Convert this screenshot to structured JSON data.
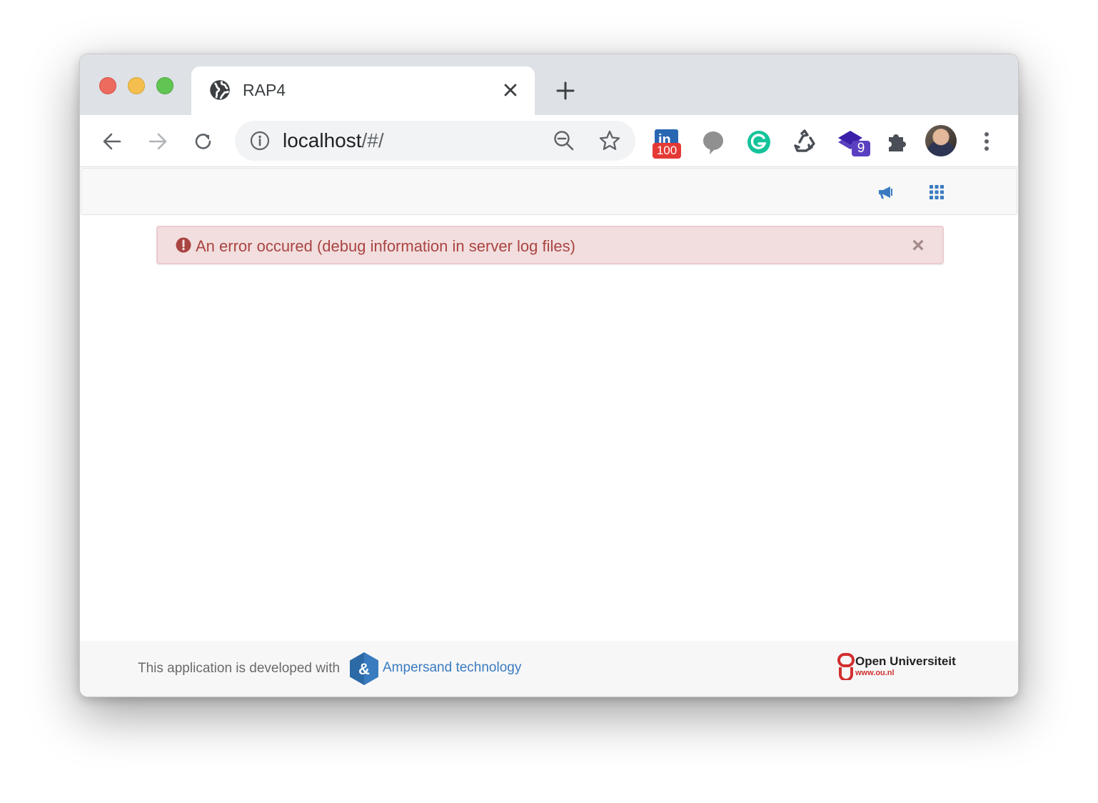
{
  "browser": {
    "tab": {
      "title": "RAP4",
      "favicon": "globe-icon"
    },
    "omnibox": {
      "host": "localhost",
      "path": "/#/"
    },
    "extensions": {
      "linkedin_badge": "100",
      "stack_badge": "9"
    },
    "colors": {
      "tabstrip": "#dee1e6",
      "linkedin_badge": "#e53935",
      "stack_badge": "#5a3fc0"
    }
  },
  "app": {
    "navbar": {
      "icons": [
        "bullhorn-icon",
        "grid-icon"
      ],
      "accent": "#3a7bc0"
    },
    "alert": {
      "message": "An error occured (debug information in server log files)",
      "close_label": "×",
      "color": "#a94442",
      "background": "#f2dede"
    },
    "footer": {
      "text": "This application is developed with",
      "logo_char": "&",
      "link_text": "Ampersand technology",
      "partner_name": "Open Universiteit",
      "partner_url": "www.ou.nl"
    }
  }
}
